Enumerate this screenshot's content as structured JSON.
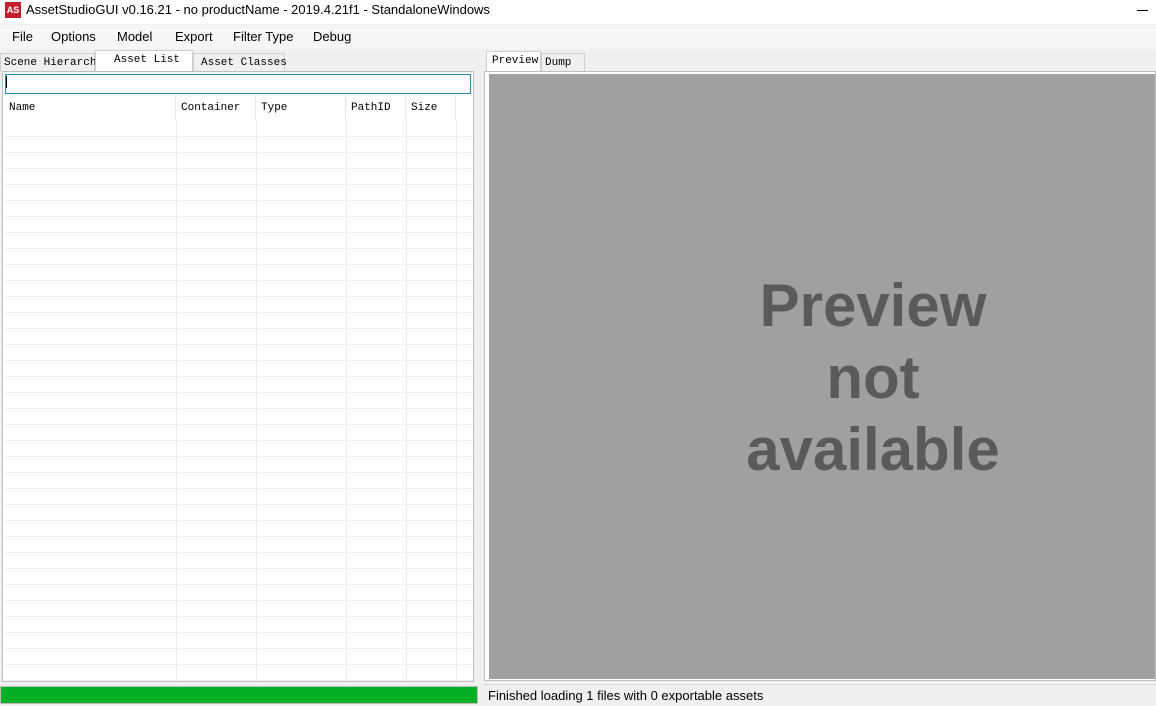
{
  "window": {
    "title": "AssetStudioGUI v0.16.21 - no productName - 2019.4.21f1 - StandaloneWindows",
    "icon_label": "AS",
    "icon_color": "#c4202a"
  },
  "menu": {
    "items": [
      "File",
      "Options",
      "Model",
      "Export",
      "Filter Type",
      "Debug"
    ]
  },
  "left_tabs": [
    "Scene Hierarchy",
    "Asset List",
    "Asset Classes"
  ],
  "left_active_tab": "Asset List",
  "search": {
    "value": "",
    "placeholder": ""
  },
  "asset_table": {
    "columns": [
      "Name",
      "Container",
      "Type",
      "PathID",
      "Size"
    ],
    "rows": []
  },
  "progress": {
    "fraction": 1.0,
    "color": "#06b025"
  },
  "right_tabs": [
    "Preview",
    "Dump"
  ],
  "right_active_tab": "Preview",
  "preview": {
    "message": "Preview\nnot\navailable",
    "background": "#a0a0a0",
    "text_color": "#5a5a5a"
  },
  "status": {
    "text": "Finished loading 1 files with 0 exportable assets"
  }
}
